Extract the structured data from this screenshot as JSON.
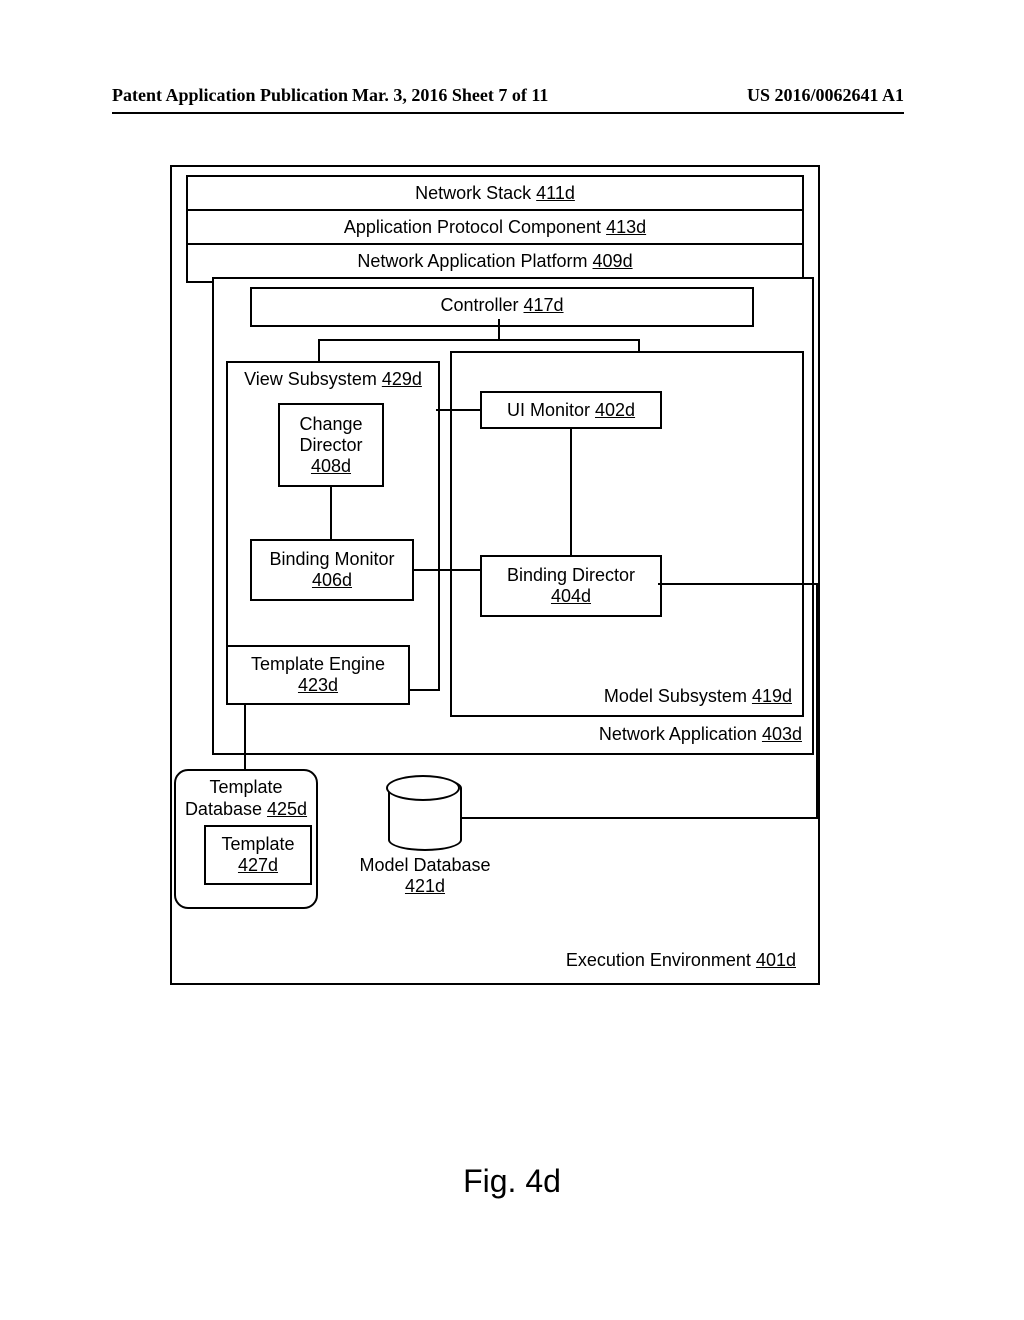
{
  "header": {
    "left": "Patent Application Publication",
    "mid": "Mar. 3, 2016  Sheet 7 of 11",
    "right": "US 2016/0062641 A1"
  },
  "figure_caption": "Fig. 4d",
  "boxes": {
    "env": {
      "label": "Execution Environment",
      "ref": "401d"
    },
    "net_stack": {
      "label": "Network Stack",
      "ref": "411d"
    },
    "app_proto": {
      "label": "Application Protocol Component",
      "ref": "413d"
    },
    "net_app_plat": {
      "label": "Network Application Platform",
      "ref": "409d"
    },
    "net_app": {
      "label": "Network Application",
      "ref": "403d"
    },
    "controller": {
      "label": "Controller",
      "ref": "417d"
    },
    "view_sub": {
      "label": "View Subsystem",
      "ref": "429d"
    },
    "change_dir": {
      "label": "Change Director",
      "ref": "408d"
    },
    "ui_mon": {
      "label": "UI Monitor",
      "ref": "402d"
    },
    "bind_mon": {
      "label": "Binding Monitor",
      "ref": "406d"
    },
    "bind_dir": {
      "label": "Binding Director",
      "ref": "404d"
    },
    "tmpl_eng": {
      "label": "Template Engine",
      "ref": "423d"
    },
    "model_sub": {
      "label": "Model Subsystem",
      "ref": "419d"
    },
    "tmpl_db": {
      "label": "Template Database",
      "ref": "425d"
    },
    "tmpl": {
      "label": "Template",
      "ref": "427d"
    },
    "model_db": {
      "label": "Model Database",
      "ref": "421d"
    }
  }
}
